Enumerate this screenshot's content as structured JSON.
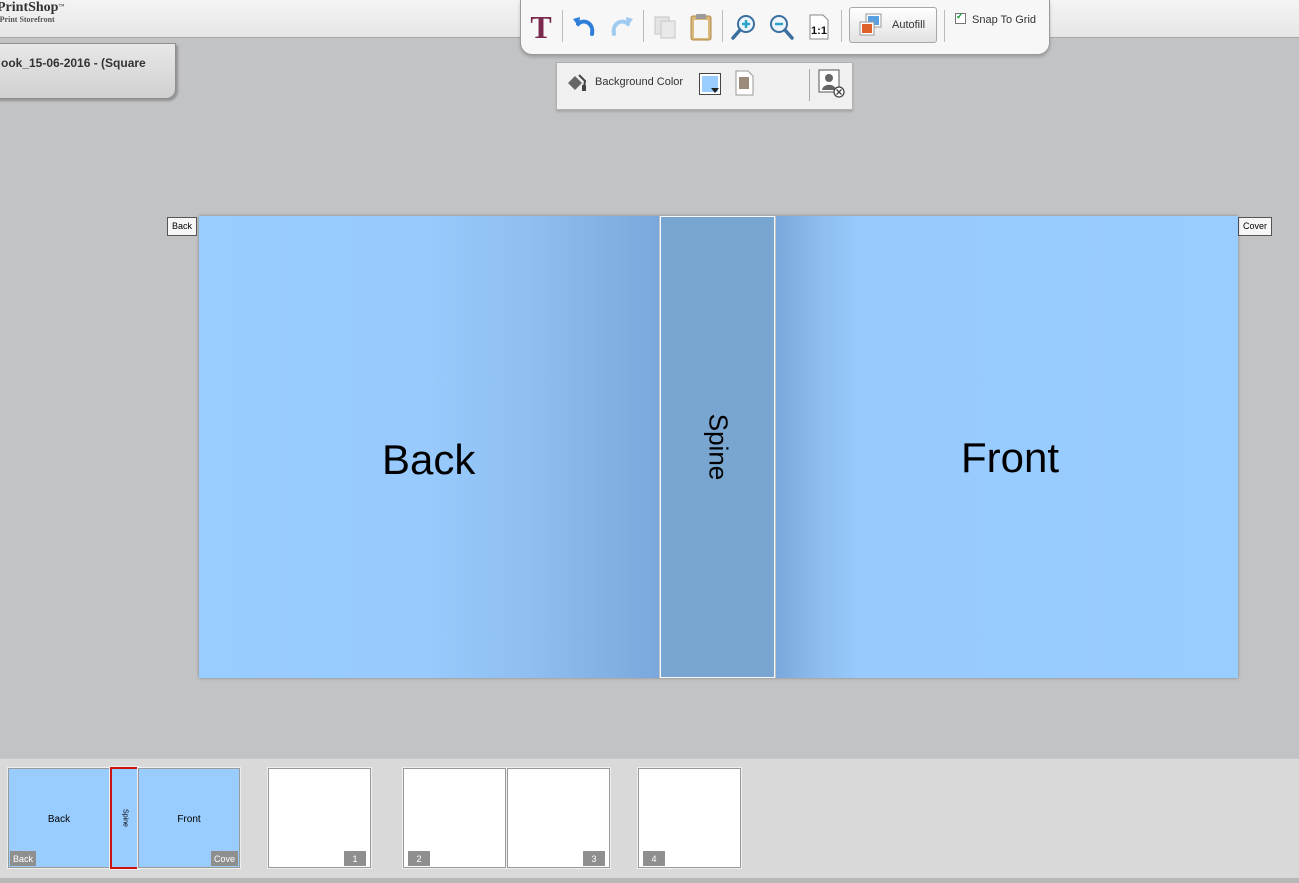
{
  "app": {
    "logo": "PrintShop",
    "logo_tm": "™",
    "logo_sub": "-Print Storefront"
  },
  "document": {
    "tab_title": "ook_15-06-2016 - (Square"
  },
  "toolbar": {
    "autofill_label": "Autofill",
    "snap_to_grid_label": "Snap To Grid",
    "snap_to_grid_checked": true,
    "text_tool_glyph": "T",
    "actual_size_label": "1:1"
  },
  "subtoolbar": {
    "background_color_label": "Background Color",
    "background_color": "#99ccff"
  },
  "canvas": {
    "back_tag": "Back",
    "cover_tag": "Cover",
    "back_label": "Back",
    "spine_label": "Spine",
    "front_label": "Front"
  },
  "page_strip": {
    "cover": {
      "back": "Back",
      "spine": "Spine",
      "front": "Front",
      "back_badge": "Back",
      "cover_badge": "Cove"
    },
    "pages": [
      "1",
      "2",
      "3",
      "4"
    ]
  },
  "colors": {
    "page_blue": "#99ccff",
    "spine_blue": "#79a6d0",
    "selected_outline": "#cc1111",
    "text_tool": "#7a2b4d"
  }
}
